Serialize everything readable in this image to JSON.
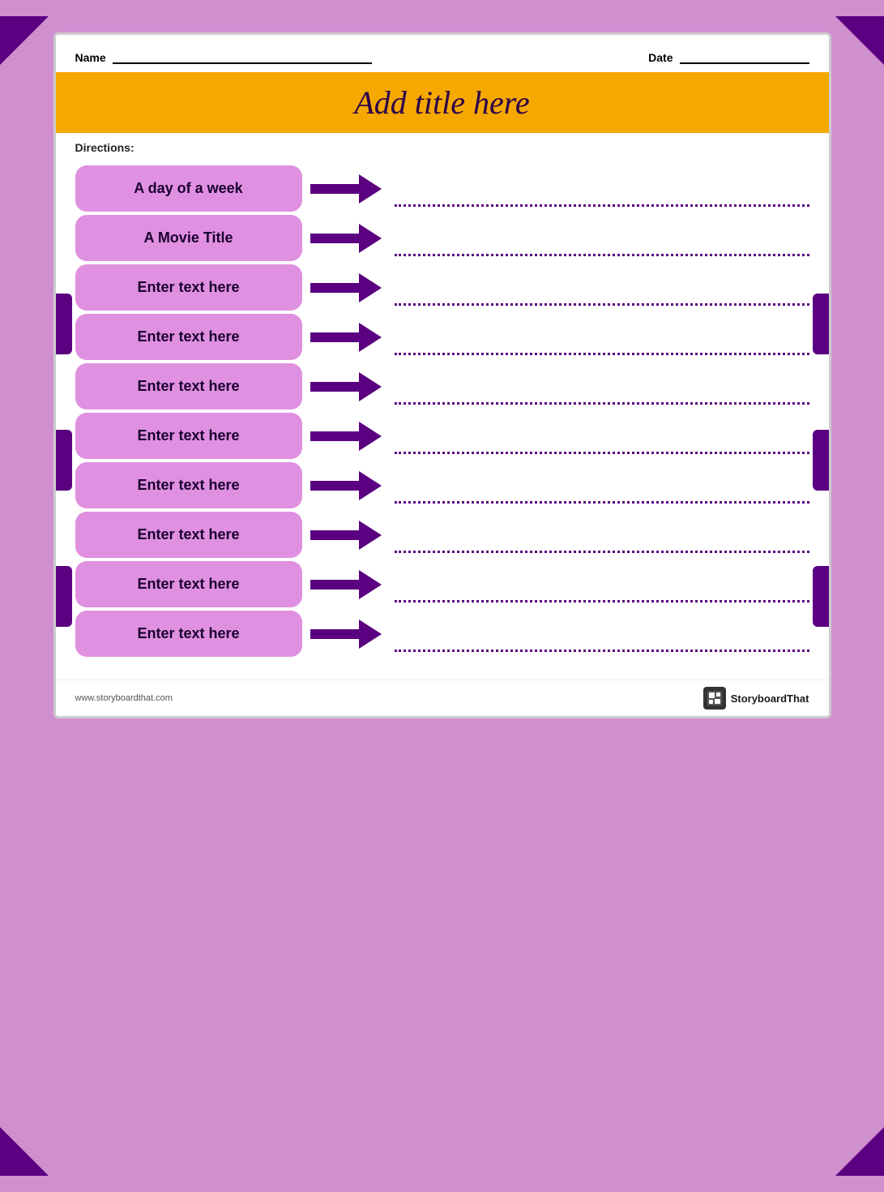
{
  "page": {
    "background_color": "#d090d0",
    "border_color": "#cccccc"
  },
  "header": {
    "name_label": "Name",
    "date_label": "Date"
  },
  "title_bar": {
    "title": "Add title here",
    "background": "#f5a800"
  },
  "directions": {
    "label": "Directions:"
  },
  "rows": [
    {
      "id": 1,
      "label": "A day of a week"
    },
    {
      "id": 2,
      "label": "A Movie Title"
    },
    {
      "id": 3,
      "label": "Enter text here"
    },
    {
      "id": 4,
      "label": "Enter text here"
    },
    {
      "id": 5,
      "label": "Enter text here"
    },
    {
      "id": 6,
      "label": "Enter text here"
    },
    {
      "id": 7,
      "label": "Enter text here"
    },
    {
      "id": 8,
      "label": "Enter text here"
    },
    {
      "id": 9,
      "label": "Enter text here"
    },
    {
      "id": 10,
      "label": "Enter text here"
    }
  ],
  "footer": {
    "website": "www.storyboardthat.com",
    "brand": "StoryboardThat"
  },
  "side_tabs": [
    {
      "top_pct": 35
    },
    {
      "top_pct": 55
    },
    {
      "top_pct": 75
    }
  ]
}
